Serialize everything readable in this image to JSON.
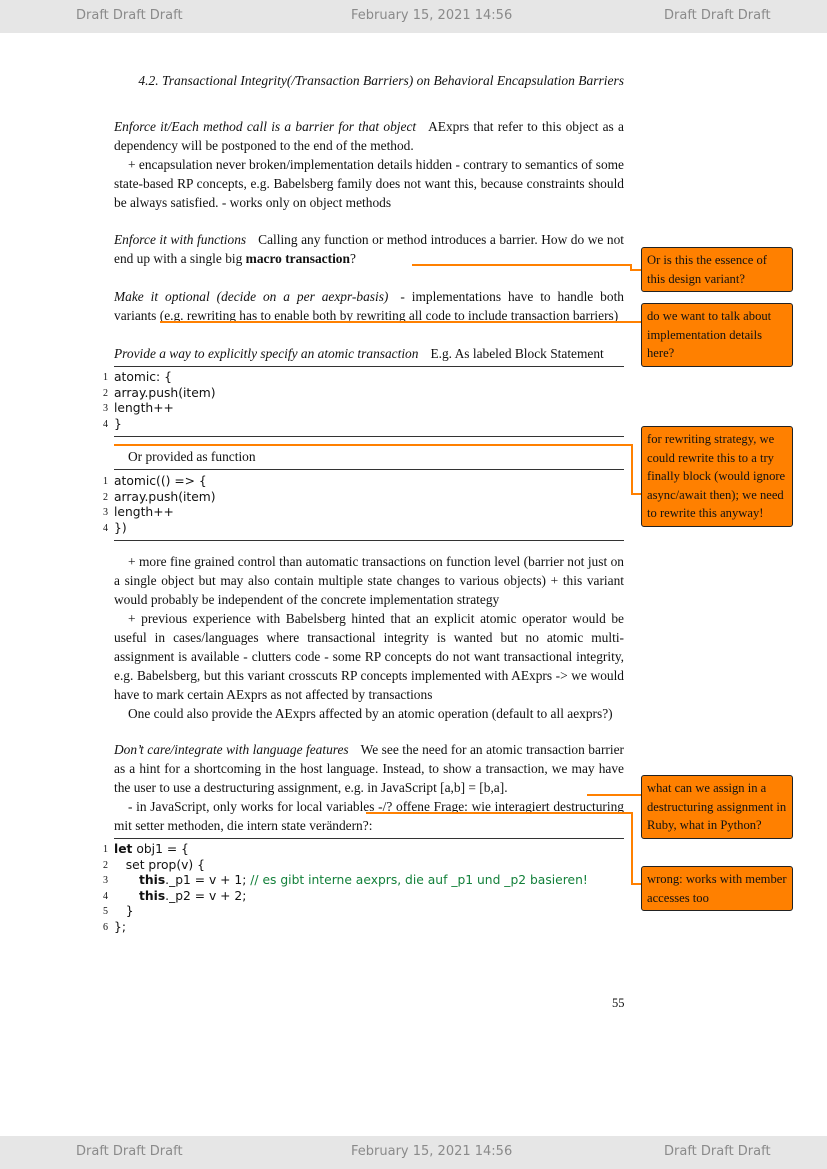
{
  "draft_bar": {
    "left": "Draft Draft Draft",
    "center": "February 15, 2021 14:56",
    "right": "Draft Draft Draft"
  },
  "running_header": "4.2.   Transactional Integrity(/Transaction Barriers) on Behavioral Encapsulation Barriers",
  "sections": {
    "s1": {
      "title": "Enforce it/Each method call is a barrier for that object",
      "body": "AExprs that refer to this object as a dependency will be postponed to the end of the method.",
      "p2": "+ encapsulation never broken/implementation details hidden - contrary to semantics of some state-based RP concepts, e.g. Babelsberg family does not want this, because constraints should be always satisfied. - works only on object methods"
    },
    "s2": {
      "title": "Enforce it with functions",
      "body_pre": "Calling any function or method introduces a barrier. How do we not end up with a single big ",
      "body_bold": "macro transaction",
      "body_post": "?"
    },
    "s3": {
      "title": "Make it optional (decide on a per aexpr-basis)",
      "body": "- implementations have to handle both variants (e.g. rewriting has to enable both by rewriting all code to include transaction barriers)"
    },
    "s4": {
      "title": "Provide a way to explicitly specify an atomic transaction",
      "body": "E.g. As labeled Block Statement",
      "alt": "Or provided as function",
      "p1": "+ more fine grained control than automatic transactions on function level (barrier not just on a single object but may also contain multiple state changes to various objects) + this variant would probably be independent of the concrete implementation strategy",
      "p2": "+ previous experience with Babelsberg hinted that an explicit atomic operator would be useful in cases/languages where transactional integrity is wanted but no atomic multi-assignment is available - clutters code - some RP concepts do not want transactional integrity, e.g. Babelsberg, but this variant crosscuts RP concepts implemented with AExprs -> we would have to mark certain AExprs as not affected by transactions",
      "p3": "One could also provide the AExprs affected by an atomic operation (default to all aexprs?)"
    },
    "s5": {
      "title": "Don’t care/integrate with language features",
      "body": "We see the need for an atomic transaction barrier as a hint for a shortcoming in the host language. Instead, to show a transaction, we may have the user to use a destructuring assignment, e.g. in JavaScript [a,b] = [b,a].",
      "p2": "- in JavaScript, only works for local variables -/? offene Frage: wie interagiert destructuring mit setter methoden, die intern state verändern?:"
    }
  },
  "code1": [
    {
      "n": "1",
      "t": "atomic: {"
    },
    {
      "n": "2",
      "t": "array.push(item)"
    },
    {
      "n": "3",
      "t": "length++"
    },
    {
      "n": "4",
      "t": "}"
    }
  ],
  "code2": [
    {
      "n": "1",
      "t": "atomic(() => {"
    },
    {
      "n": "2",
      "t": "array.push(item)"
    },
    {
      "n": "3",
      "t": "length++"
    },
    {
      "n": "4",
      "t": "})"
    }
  ],
  "code3": [
    {
      "n": "1",
      "kw": "let",
      "t": " obj1 = {",
      "cm": ""
    },
    {
      "n": "2",
      "kw": "",
      "t": "   set prop(v) {",
      "cm": ""
    },
    {
      "n": "3",
      "kw": "this",
      "t": "._p1 = v + 1; ",
      "cm": "// es gibt interne aexprs, die auf _p1 und _p2 basieren!"
    },
    {
      "n": "4",
      "kw": "this",
      "t": "._p2 = v + 2;",
      "cm": ""
    },
    {
      "n": "5",
      "kw": "",
      "t": "   }",
      "cm": ""
    },
    {
      "n": "6",
      "kw": "",
      "t": "};",
      "cm": ""
    }
  ],
  "notes": {
    "n1": "Or is this the essence of this design variant?",
    "n2": "do we want to talk about implementation details here?",
    "n3": "for rewriting strategy, we could rewrite this to a try finally block (would ignore async/await then); we need to rewrite this anyway!",
    "n4": "what can we assign in a destructuring assignment in Ruby, what in Python?",
    "n5": "wrong: works with member accesses too"
  },
  "page_number": "55",
  "colors": {
    "note": "#ff8000",
    "comment": "#13803a",
    "draft_bar": "#e6e6e6"
  }
}
